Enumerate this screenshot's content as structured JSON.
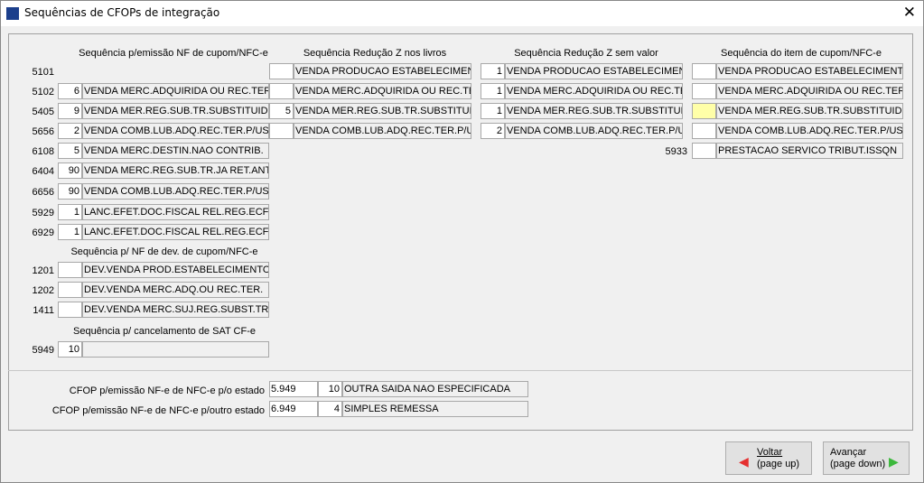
{
  "window": {
    "title": "Sequências de CFOPs de integração",
    "close": "✕"
  },
  "headers": {
    "emissao": "Sequência p/emissão NF de cupom/NFC-e",
    "reducao_livros": "Sequência Redução Z nos livros",
    "reducao_sem_valor": "Sequência Redução Z sem valor",
    "item": "Sequência do item de cupom/NFC-e",
    "devolucao": "Sequência p/ NF de dev. de cupom/NFC-e",
    "cancelamento": "Sequência p/ cancelamento de SAT CF-e"
  },
  "emissao": [
    {
      "cfop": "5101",
      "seq": null,
      "desc": null
    },
    {
      "cfop": "5102",
      "seq": "6",
      "desc": "VENDA MERC.ADQUIRIDA OU REC.TER."
    },
    {
      "cfop": "5405",
      "seq": "9",
      "desc": "VENDA MER.REG.SUB.TR.SUBSTITUIDO"
    },
    {
      "cfop": "5656",
      "seq": "2",
      "desc": "VENDA COMB.LUB.ADQ.REC.TER.P/USO"
    },
    {
      "cfop": "6108",
      "seq": "5",
      "desc": "VENDA MERC.DESTIN.NAO CONTRIB."
    },
    {
      "cfop": "6404",
      "seq": "90",
      "desc": "VENDA MERC.REG.SUB.TR.JA RET.ANT"
    },
    {
      "cfop": "6656",
      "seq": "90",
      "desc": "VENDA COMB.LUB.ADQ.REC.TER.P/USO"
    },
    {
      "cfop": "5929",
      "seq": "1",
      "desc": "LANC.EFET.DOC.FISCAL REL.REG.ECF"
    },
    {
      "cfop": "6929",
      "seq": "1",
      "desc": "LANC.EFET.DOC.FISCAL REL.REG.ECF"
    }
  ],
  "reducao_livros": [
    {
      "seq": "",
      "desc": "VENDA PRODUCAO ESTABELECIMENTO"
    },
    {
      "seq": "",
      "desc": "VENDA MERC.ADQUIRIDA OU REC.TER."
    },
    {
      "seq": "5",
      "desc": "VENDA MER.REG.SUB.TR.SUBSTITUIDO"
    },
    {
      "seq": "",
      "desc": "VENDA COMB.LUB.ADQ.REC.TER.P/USO"
    }
  ],
  "reducao_sem_valor": [
    {
      "seq": "1",
      "desc": "VENDA PRODUCAO ESTABELECIMENTO"
    },
    {
      "seq": "1",
      "desc": "VENDA MERC.ADQUIRIDA OU REC.TER."
    },
    {
      "seq": "1",
      "desc": "VENDA MER.REG.SUB.TR.SUBSTITUIDO"
    },
    {
      "seq": "2",
      "desc": "VENDA COMB.LUB.ADQ.REC.TER.P/USO"
    }
  ],
  "item": [
    {
      "seq": "",
      "desc": "VENDA PRODUCAO ESTABELECIMENTO"
    },
    {
      "seq": "",
      "desc": "VENDA MERC.ADQUIRIDA OU REC.TER."
    },
    {
      "seq": "",
      "desc": "VENDA MER.REG.SUB.TR.SUBSTITUIDO",
      "focused": true
    },
    {
      "seq": "",
      "desc": "VENDA COMB.LUB.ADQ.REC.TER.P/USO"
    },
    {
      "cfop": "5933",
      "seq": "",
      "desc": "PRESTACAO SERVICO TRIBUT.ISSQN"
    }
  ],
  "devolucao": [
    {
      "cfop": "1201",
      "seq": "",
      "desc": "DEV.VENDA PROD.ESTABELECIMENTO"
    },
    {
      "cfop": "1202",
      "seq": "",
      "desc": "DEV.VENDA MERC.ADQ.OU REC.TER."
    },
    {
      "cfop": "1411",
      "seq": "",
      "desc": "DEV.VENDA MERC.SUJ.REG.SUBST.TR."
    }
  ],
  "cancelamento": [
    {
      "cfop": "5949",
      "seq": "10",
      "desc": ""
    }
  ],
  "cfop_estado": {
    "label": "CFOP p/emissão NF-e de NFC-e p/o estado",
    "cfop": "5.949",
    "seq": "10",
    "desc": "OUTRA SAIDA NAO ESPECIFICADA"
  },
  "cfop_outro_estado": {
    "label": "CFOP p/emissão NF-e de NFC-e p/outro estado",
    "cfop": "6.949",
    "seq": "4",
    "desc": "SIMPLES REMESSA"
  },
  "buttons": {
    "back": {
      "label": "Voltar",
      "sub": "(page up)"
    },
    "next": {
      "label": "Avançar",
      "sub": "(page down)"
    }
  },
  "colors": {
    "focus": "#ffffa8",
    "back_arrow": "#e53030",
    "next_arrow": "#3cb83c"
  }
}
